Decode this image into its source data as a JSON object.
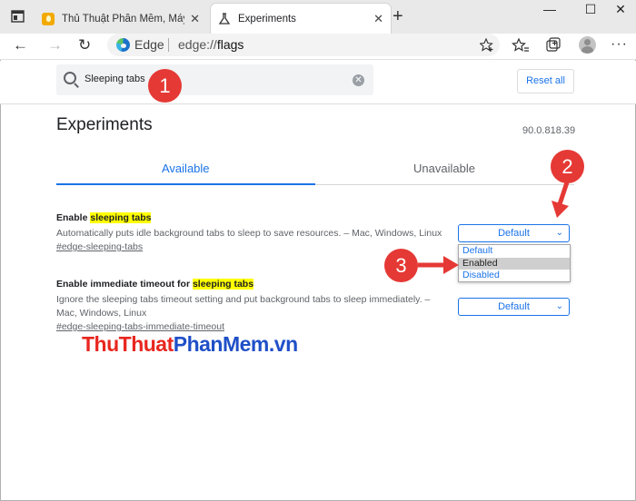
{
  "browser": {
    "tabs": [
      {
        "title": "Thủ Thuật Phần Mềm, Máy Tính,",
        "close": "✕",
        "favicon": "lightbulb-icon"
      },
      {
        "title": "Experiments",
        "close": "✕",
        "favicon": "flask-icon"
      }
    ],
    "new_tab": "+",
    "window_controls": {
      "minimize": "—",
      "maximize": "☐",
      "close": "✕"
    },
    "omnibox": {
      "brand": "Edge",
      "url_scheme": "edge://",
      "url_path": "flags"
    }
  },
  "flags_page": {
    "search_value": "Sleeping tabs",
    "reset_label": "Reset all",
    "title": "Experiments",
    "version": "90.0.818.39",
    "tabs": {
      "available": "Available",
      "unavailable": "Unavailable"
    },
    "experiments": [
      {
        "name_prefix": "Enable ",
        "name_highlight": "sleeping tabs",
        "description": "Automatically puts idle background tabs to sleep to save resources. – Mac, Windows, Linux",
        "link": "#edge-sleeping-tabs",
        "select_value": "Default"
      },
      {
        "name_prefix": "Enable immediate timeout for ",
        "name_highlight": "sleeping tabs",
        "description": "Ignore the sleeping tabs timeout setting and put background tabs to sleep immediately. – Mac, Windows, Linux",
        "link": "#edge-sleeping-tabs-immediate-timeout",
        "select_value": "Default"
      }
    ],
    "dropdown_options": [
      "Default",
      "Enabled",
      "Disabled"
    ],
    "dropdown_selected": "Enabled"
  },
  "annotations": {
    "step1": "1",
    "step2": "2",
    "step3": "3",
    "color": "#e53935"
  },
  "watermark": {
    "part1": "ThuThuat",
    "part2": "PhanMem",
    "part3": ".vn"
  }
}
